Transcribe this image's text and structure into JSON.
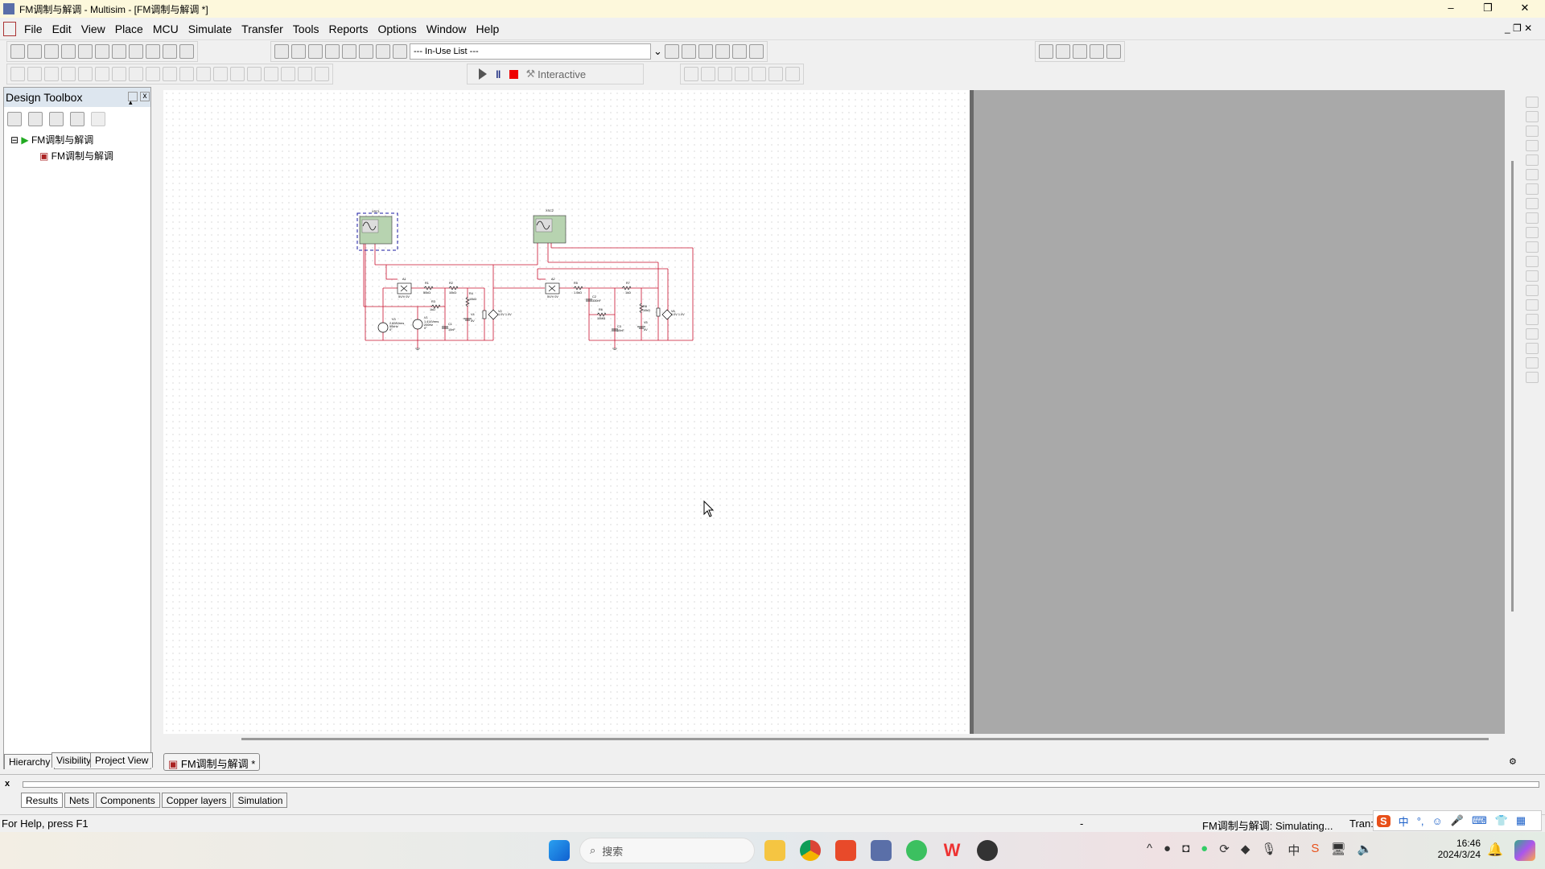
{
  "window": {
    "title": "FM调制与解调 - Multisim - [FM调制与解调 *]",
    "controls": [
      "–",
      "❐",
      "✕"
    ]
  },
  "menu": [
    "File",
    "Edit",
    "View",
    "Place",
    "MCU",
    "Simulate",
    "Transfer",
    "Tools",
    "Reports",
    "Options",
    "Window",
    "Help"
  ],
  "toolbar1": {
    "file_icons": [
      "new-icon",
      "open-icon",
      "open-sample-icon",
      "save-icon",
      "print-icon",
      "print-preview-icon",
      "cut-icon",
      "copy-icon",
      "paste-icon",
      "undo-icon",
      "redo-icon"
    ],
    "view_icons": [
      "design-toolbox-icon",
      "spreadsheet-icon",
      "spice-netlist-icon",
      "grapher-icon",
      "database-icon",
      "component-wizard-icon",
      "postprocessor-icon",
      "electrical-rules-icon"
    ],
    "in_use_list": "--- In-Use List ---",
    "right_icons": [
      "erc-icon",
      "transfer-ultiboard-icon",
      "backannotate-icon",
      "forward-annotate-icon",
      "find-examples-icon",
      "help-icon"
    ],
    "zoom_icons": [
      "zoom-in-icon",
      "zoom-out-icon",
      "zoom-area-icon",
      "zoom-sheet-icon",
      "full-screen-icon"
    ]
  },
  "toolbar2": {
    "component_icons": [
      "source-icon",
      "basic-icon",
      "diode-icon",
      "transistor-icon",
      "analog-icon",
      "ttl-icon",
      "cmos-icon",
      "mcu-icon",
      "indicator-icon",
      "power-icon",
      "misc-digital-icon",
      "misc-icon",
      "advanced-peripherals-icon",
      "rf-icon",
      "electromechanical-icon",
      "ladder-icon",
      "mcu-module-icon",
      "hierarchical-block-icon",
      "bus-icon"
    ],
    "sim_label": "Interactive",
    "probe_icons": [
      "voltage-probe-icon",
      "current-probe-icon",
      "power-probe-icon",
      "differential-probe-icon",
      "voltage-reference-probe-icon",
      "digital-probe-icon",
      "probe-settings-icon"
    ]
  },
  "toolbox": {
    "title": "Design Toolbox",
    "tree_root": "FM调制与解调",
    "tree_child": "FM调制与解调",
    "tabs": [
      "Hierarchy",
      "Visibility",
      "Project View"
    ]
  },
  "sheet_tab": "FM调制与解调 *",
  "circuit": {
    "labels": [
      {
        "t": "XSC1"
      },
      {
        "t": "XSC2"
      },
      {
        "t": "A1"
      },
      {
        "t": "5V/V 0V"
      },
      {
        "t": "A2"
      },
      {
        "t": "5V/V 0V"
      },
      {
        "t": "R1"
      },
      {
        "t": "50kΩ"
      },
      {
        "t": "R2"
      },
      {
        "t": "10kΩ"
      },
      {
        "t": "R3"
      },
      {
        "t": "1kΩ"
      },
      {
        "t": "R4"
      },
      {
        "t": "10kΩ"
      },
      {
        "t": "V4"
      },
      {
        "t": "5V"
      },
      {
        "t": "C1"
      },
      {
        "t": "10nF"
      },
      {
        "t": "V3"
      },
      {
        "t": "2.828Vrms"
      },
      {
        "t": "50kHz"
      },
      {
        "t": "0°"
      },
      {
        "t": "V1"
      },
      {
        "t": "1.414Vrms"
      },
      {
        "t": "200Hz"
      },
      {
        "t": "0°"
      },
      {
        "t": "V2"
      },
      {
        "t": "1.0V 1.0V"
      },
      {
        "t": "R5"
      },
      {
        "t": "1.0kΩ"
      },
      {
        "t": "C2"
      },
      {
        "t": "330nF"
      },
      {
        "t": "R6"
      },
      {
        "t": "10MΩ"
      },
      {
        "t": "C3"
      },
      {
        "t": "10nF"
      },
      {
        "t": "R7"
      },
      {
        "t": "1kΩ"
      },
      {
        "t": "R8"
      },
      {
        "t": "10kΩ"
      },
      {
        "t": "V5"
      },
      {
        "t": "5V"
      },
      {
        "t": "V6"
      },
      {
        "t": "1.0V 1.0V"
      }
    ],
    "wire_color": "#c8102e",
    "selection_color": "#1a1aa0",
    "scope_color": "#b7d3b0"
  },
  "spreadsheet": {
    "tabs": [
      "Results",
      "Nets",
      "Components",
      "Copper layers",
      "Simulation"
    ],
    "active": "Results"
  },
  "status": {
    "help": "For Help, press F1",
    "dash": "-",
    "sim": "FM调制与解调: Simulating...",
    "tran": "Tran:"
  },
  "taskbar": {
    "search": "搜索",
    "time": "16:46",
    "date": "2024/3/24",
    "ime": "中"
  }
}
